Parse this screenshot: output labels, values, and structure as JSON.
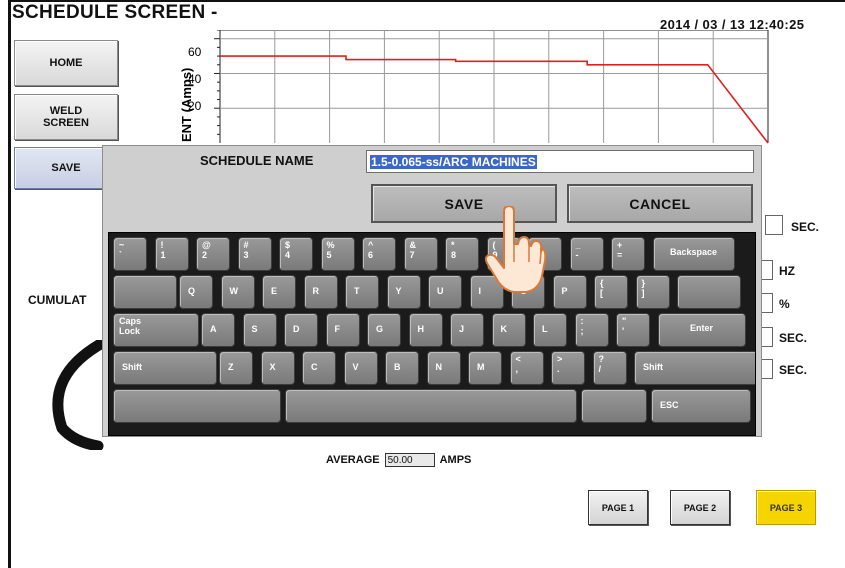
{
  "header": {
    "title": "SCHEDULE SCREEN -",
    "datetime": "2014 / 03 / 13   12:40:25"
  },
  "nav": {
    "home": "HOME",
    "weld_line1": "WELD",
    "weld_line2": "SCREEN",
    "save": "SAVE"
  },
  "chart": {
    "y_label": "ENT (Amps)",
    "y_ticks": [
      "60",
      "40",
      "20"
    ],
    "line_color": "#e02020"
  },
  "chart_data": {
    "type": "line",
    "title": "",
    "ylabel": "ENT (Amps)",
    "xlabel": "",
    "y_ticks": [
      60,
      40,
      20
    ],
    "ylim": [
      0,
      65
    ],
    "xlim": [
      0,
      100
    ],
    "series": [
      {
        "values_xy": [
          [
            0,
            50
          ],
          [
            23,
            50
          ],
          [
            23,
            48
          ],
          [
            43,
            48
          ],
          [
            43,
            47
          ],
          [
            67,
            47
          ],
          [
            67,
            45
          ],
          [
            89,
            45
          ],
          [
            100,
            0
          ]
        ]
      }
    ],
    "grid": true
  },
  "labels": {
    "cumulat": "CUMULAT"
  },
  "units": [
    "SEC.",
    "HZ",
    "%",
    "SEC.",
    "SEC."
  ],
  "average": {
    "label": "AVERAGE",
    "value": "50.00",
    "unit": "AMPS"
  },
  "pages": {
    "p1": "PAGE 1",
    "p2": "PAGE 2",
    "p3": "PAGE 3",
    "active": "PAGE 3",
    "active_color": "#f5d400"
  },
  "dialog": {
    "name_label": "SCHEDULE NAME",
    "name_value": "1.5-0.065-ss/ARC MACHINES",
    "save": "SAVE",
    "cancel": "CANCEL"
  },
  "keyboard": {
    "row1": [
      [
        "~",
        "`"
      ],
      [
        "!",
        "1"
      ],
      [
        "@",
        "2"
      ],
      [
        "#",
        "3"
      ],
      [
        "$",
        "4"
      ],
      [
        "%",
        "5"
      ],
      [
        "^",
        "6"
      ],
      [
        "&",
        "7"
      ],
      [
        "*",
        "8"
      ],
      [
        "(",
        "9"
      ],
      [
        ")",
        "0"
      ],
      [
        "_",
        "-"
      ],
      [
        "+",
        "="
      ]
    ],
    "row1_special": "Backspace",
    "row2": [
      [
        "",
        "Q"
      ],
      [
        "",
        "W"
      ],
      [
        "",
        "E"
      ],
      [
        "",
        "R"
      ],
      [
        "",
        "T"
      ],
      [
        "",
        "Y"
      ],
      [
        "",
        "U"
      ],
      [
        "",
        "I"
      ],
      [
        "",
        "O"
      ],
      [
        "",
        "P"
      ],
      [
        "{",
        "["
      ],
      [
        "}",
        "]"
      ]
    ],
    "row3_caps_line1": "Caps",
    "row3_caps_line2": "Lock",
    "row3": [
      [
        "",
        "A"
      ],
      [
        "",
        "S"
      ],
      [
        "",
        "D"
      ],
      [
        "",
        "F"
      ],
      [
        "",
        "G"
      ],
      [
        "",
        "H"
      ],
      [
        "",
        "J"
      ],
      [
        "",
        "K"
      ],
      [
        "",
        "L"
      ],
      [
        ":",
        ";"
      ],
      [
        "\"",
        "'"
      ]
    ],
    "row3_enter": "Enter",
    "row4_shift_left": "Shift",
    "row4": [
      [
        "",
        "Z"
      ],
      [
        "",
        "X"
      ],
      [
        "",
        "C"
      ],
      [
        "",
        "V"
      ],
      [
        "",
        "B"
      ],
      [
        "",
        "N"
      ],
      [
        "",
        "M"
      ],
      [
        "<",
        ","
      ],
      [
        ">",
        "."
      ],
      [
        "?",
        "/"
      ]
    ],
    "row4_shift_right": "Shift",
    "esc": "ESC"
  },
  "cursor": {
    "icon": "pointing-hand-icon"
  }
}
